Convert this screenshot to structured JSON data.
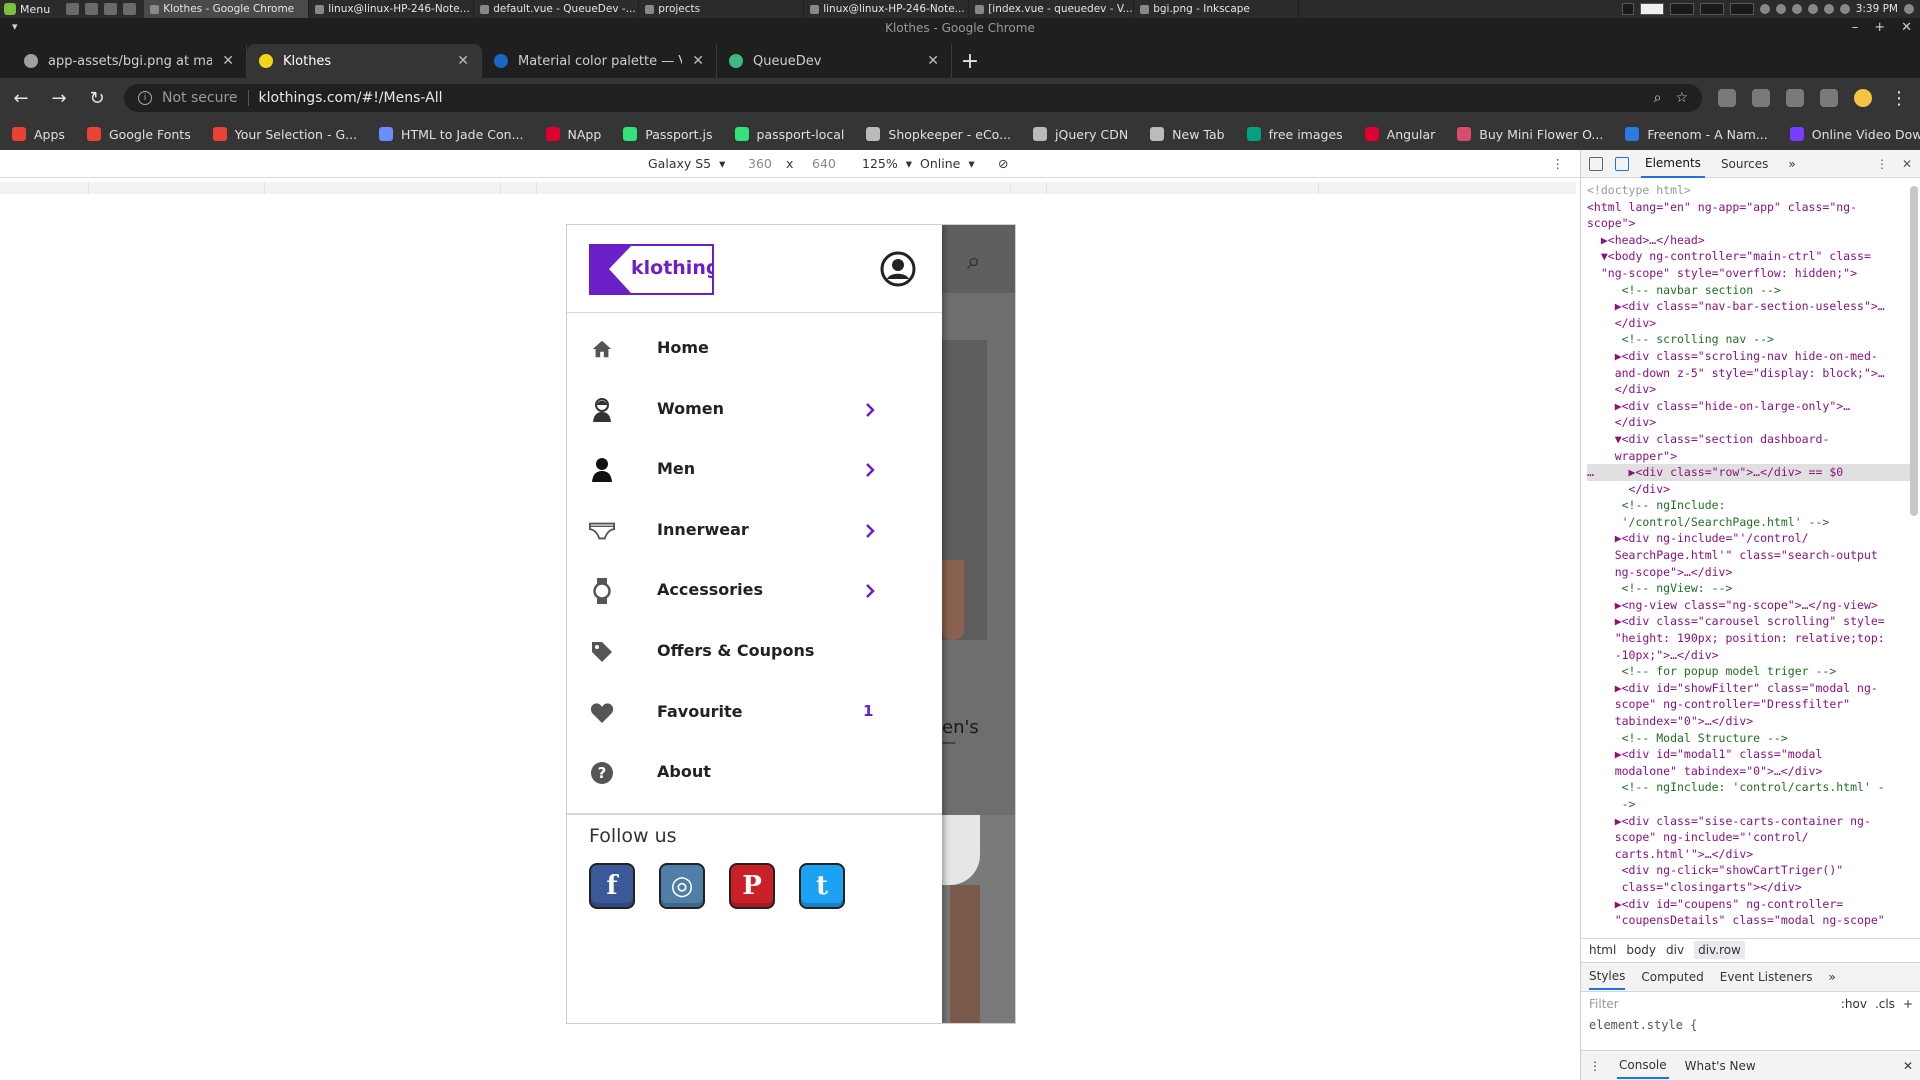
{
  "os": {
    "menu_label": "Menu",
    "tasks": [
      {
        "label": "Klothes - Google Chrome",
        "active": true
      },
      {
        "label": "linux@linux-HP-246-Note..."
      },
      {
        "label": "default.vue - QueueDev -..."
      },
      {
        "label": "projects"
      },
      {
        "label": "linux@linux-HP-246-Note..."
      },
      {
        "label": "[index.vue - queuedev - V..."
      },
      {
        "label": "bgi.png - Inkscape"
      }
    ],
    "clock": "3:39 PM"
  },
  "window": {
    "title": "Klothes - Google Chrome"
  },
  "browser": {
    "tabs": [
      {
        "label": "app-assets/bgi.png at master ·",
        "color": "#9aa0a6",
        "active": false
      },
      {
        "label": "Klothes",
        "color": "#f4d31a",
        "active": true
      },
      {
        "label": "Material color palette — Vuetify",
        "color": "#1867c0",
        "active": false
      },
      {
        "label": "QueueDev",
        "color": "#41b883",
        "active": false
      }
    ],
    "new_tab_symbol": "+",
    "security_label": "Not secure",
    "url": "klothings.com/#!/Mens-All",
    "bookmarks": [
      {
        "label": "Apps",
        "color": "#e94235"
      },
      {
        "label": "Google Fonts",
        "color": "#ea4335"
      },
      {
        "label": "Your Selection - G...",
        "color": "#ea4335"
      },
      {
        "label": "HTML to Jade Con...",
        "color": "#6b8cff"
      },
      {
        "label": "NApp",
        "color": "#dd0031"
      },
      {
        "label": "Passport.js",
        "color": "#34e27a"
      },
      {
        "label": "passport-local",
        "color": "#34e27a"
      },
      {
        "label": "Shopkeeper - eCo...",
        "color": "#bbbbbb"
      },
      {
        "label": "jQuery CDN",
        "color": "#bbbbbb"
      },
      {
        "label": "New Tab",
        "color": "#bbbbbb"
      },
      {
        "label": "free images",
        "color": "#05a081"
      },
      {
        "label": "Angular",
        "color": "#dd0031"
      },
      {
        "label": "Buy Mini Flower O...",
        "color": "#d94c6e"
      },
      {
        "label": "Freenom - A Nam...",
        "color": "#2a7ae2"
      },
      {
        "label": "Online Video Dow...",
        "color": "#7a3cff"
      }
    ],
    "bookmarks_more": "»"
  },
  "device_toolbar": {
    "device": "Galaxy S5",
    "width": "360",
    "times": "x",
    "height": "640",
    "zoom": "125%",
    "network": "Online"
  },
  "app": {
    "logo_text": "klothings",
    "menu": [
      {
        "label": "Home",
        "icon": "home-icon",
        "has_submenu": false,
        "count": ""
      },
      {
        "label": "Women",
        "icon": "woman-icon",
        "has_submenu": true,
        "count": ""
      },
      {
        "label": "Men",
        "icon": "man-icon",
        "has_submenu": true,
        "count": ""
      },
      {
        "label": "Innerwear",
        "icon": "underwear-icon",
        "has_submenu": true,
        "count": ""
      },
      {
        "label": "Accessories",
        "icon": "watch-icon",
        "has_submenu": true,
        "count": ""
      },
      {
        "label": "Offers & Coupons",
        "icon": "tag-icon",
        "has_submenu": false,
        "count": ""
      },
      {
        "label": "Favourite",
        "icon": "heart-icon",
        "has_submenu": false,
        "count": "1"
      },
      {
        "label": "About",
        "icon": "help-icon",
        "has_submenu": false,
        "count": ""
      }
    ],
    "follow_title": "Follow us",
    "social": [
      {
        "name": "facebook",
        "glyph": "f",
        "color": "#3b5998"
      },
      {
        "name": "instagram",
        "glyph": "◎",
        "color": "#4f7fa6"
      },
      {
        "name": "pinterest",
        "glyph": "P",
        "color": "#cb2027"
      },
      {
        "name": "twitter",
        "glyph": "t",
        "color": "#1da1f2"
      }
    ],
    "background_text": "en's",
    "accent_color": "#6b1fc7"
  },
  "devtools": {
    "tabs": [
      "Elements",
      "Sources"
    ],
    "more": "»",
    "dom_lines": [
      {
        "text": "<!doctype html>",
        "type": "muted"
      },
      {
        "text": "<html lang=\"en\" ng-app=\"app\" class=\"ng-",
        "type": "tag"
      },
      {
        "text": "scope\">",
        "type": "tag"
      },
      {
        "text": "  ▶<head>…</head>",
        "type": "tag"
      },
      {
        "text": "  ▼<body ng-controller=\"main-ctrl\" class=",
        "type": "tag"
      },
      {
        "text": "  \"ng-scope\" style=\"overflow: hidden;\">",
        "type": "tag"
      },
      {
        "text": "     <!-- navbar section -->",
        "type": "cm"
      },
      {
        "text": "    ▶<div class=\"nav-bar-section-useless\">…",
        "type": "tag"
      },
      {
        "text": "    </div>",
        "type": "tag"
      },
      {
        "text": "     <!-- scrolling nav -->",
        "type": "cm"
      },
      {
        "text": "    ▶<div class=\"scroling-nav hide-on-med-",
        "type": "tag"
      },
      {
        "text": "    and-down z-5\" style=\"display: block;\">…",
        "type": "tag"
      },
      {
        "text": "    </div>",
        "type": "tag"
      },
      {
        "text": "    ▶<div class=\"hide-on-large-only\">…",
        "type": "tag"
      },
      {
        "text": "    </div>",
        "type": "tag"
      },
      {
        "text": "    ▼<div class=\"section dashboard-",
        "type": "tag"
      },
      {
        "text": "    wrapper\">",
        "type": "tag"
      },
      {
        "text": "…     ▶<div class=\"row\">…</div> == $0",
        "type": "sel"
      },
      {
        "text": "      </div>",
        "type": "tag"
      },
      {
        "text": "     <!-- ngInclude:",
        "type": "cm"
      },
      {
        "text": "     '/control/SearchPage.html' -->",
        "type": "cm"
      },
      {
        "text": "    ▶<div ng-include=\"'/control/",
        "type": "tag"
      },
      {
        "text": "    SearchPage.html'\" class=\"search-output",
        "type": "tag"
      },
      {
        "text": "    ng-scope\">…</div>",
        "type": "tag"
      },
      {
        "text": "     <!-- ngView: -->",
        "type": "cm"
      },
      {
        "text": "    ▶<ng-view class=\"ng-scope\">…</ng-view>",
        "type": "tag"
      },
      {
        "text": "    ▶<div class=\"carousel scrolling\" style=",
        "type": "tag"
      },
      {
        "text": "    \"height: 190px; position: relative;top:",
        "type": "tag"
      },
      {
        "text": "    -10px;\">…</div>",
        "type": "tag"
      },
      {
        "text": "     <!-- for popup model triger -->",
        "type": "cm"
      },
      {
        "text": "    ▶<div id=\"showFilter\" class=\"modal ng-",
        "type": "tag"
      },
      {
        "text": "    scope\" ng-controller=\"Dressfilter\"",
        "type": "tag"
      },
      {
        "text": "    tabindex=\"0\">…</div>",
        "type": "tag"
      },
      {
        "text": "     <!-- Modal Structure -->",
        "type": "cm"
      },
      {
        "text": "    ▶<div id=\"modal1\" class=\"modal",
        "type": "tag"
      },
      {
        "text": "    modalone\" tabindex=\"0\">…</div>",
        "type": "tag"
      },
      {
        "text": "     <!-- ngInclude: 'control/carts.html' -",
        "type": "cm"
      },
      {
        "text": "     ->",
        "type": "cm"
      },
      {
        "text": "    ▶<div class=\"sise-carts-container ng-",
        "type": "tag"
      },
      {
        "text": "    scope\" ng-include=\"'control/",
        "type": "tag"
      },
      {
        "text": "    carts.html'\">…</div>",
        "type": "tag"
      },
      {
        "text": "     <div ng-click=\"showCartTriger()\"",
        "type": "tag"
      },
      {
        "text": "     class=\"closingarts\"></div>",
        "type": "tag"
      },
      {
        "text": "    ▶<div id=\"coupens\" ng-controller=",
        "type": "tag"
      },
      {
        "text": "    \"coupensDetails\" class=\"modal ng-scope\"",
        "type": "tag"
      }
    ],
    "breadcrumbs": [
      "html",
      "body",
      "div",
      "div.row"
    ],
    "styles_tabs": [
      "Styles",
      "Computed",
      "Event Listeners",
      "»"
    ],
    "filter_placeholder": "Filter",
    "hov": ":hov",
    "cls": ".cls",
    "plus": "+",
    "element_style": "element.style {",
    "console_tabs": [
      "Console",
      "What's New"
    ]
  }
}
